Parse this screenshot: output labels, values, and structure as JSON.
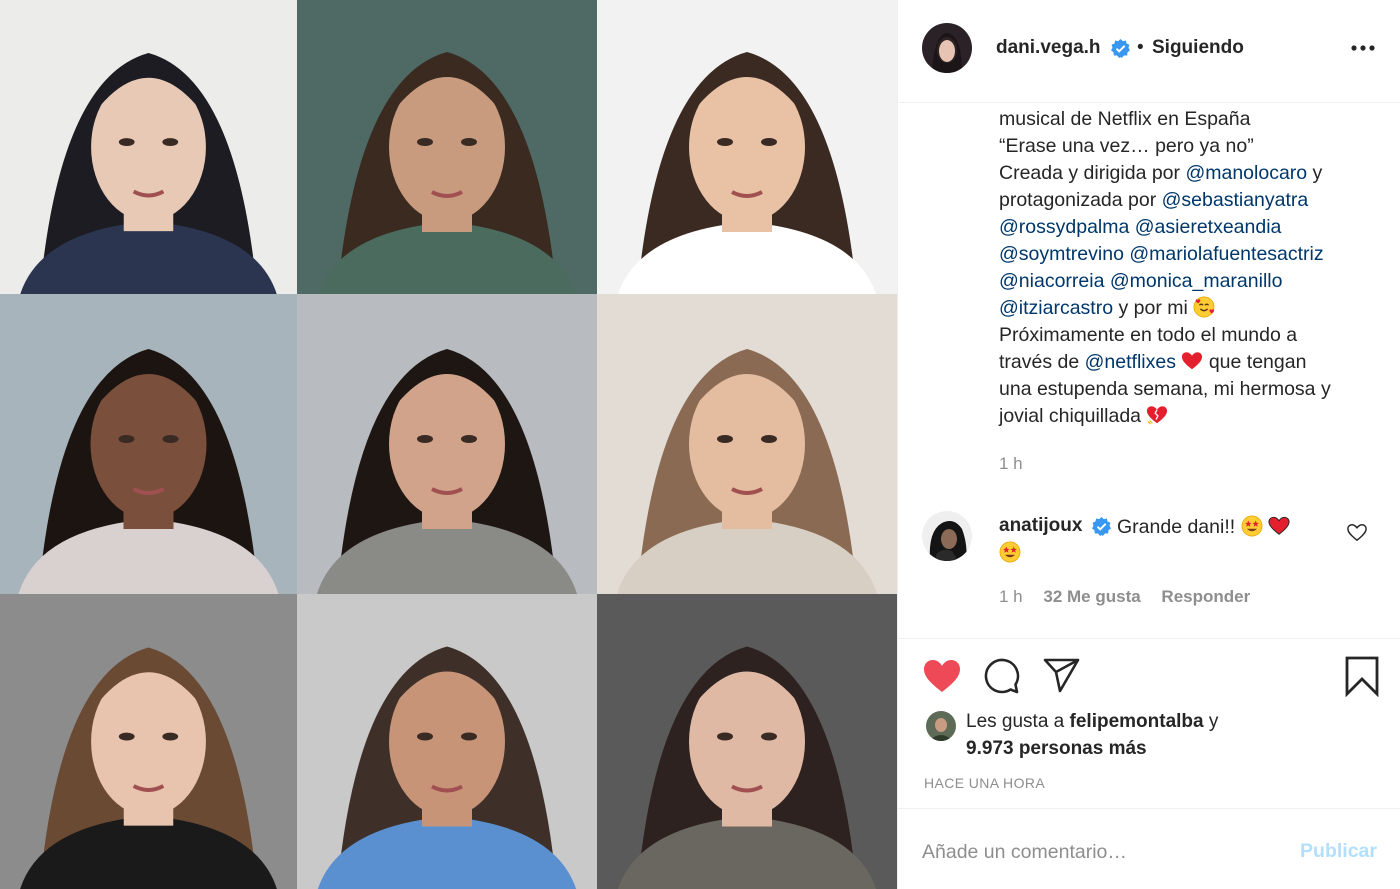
{
  "post": {
    "grid_photos": [
      {
        "name": "portrait-1",
        "bg": "#ececea",
        "skin": "#e8c9b6",
        "hair": "#1c1c22",
        "cloth": "#2b3550"
      },
      {
        "name": "portrait-2",
        "bg": "#4f6a64",
        "skin": "#c89a7e",
        "hair": "#3a2a20",
        "cloth": "#4a6b5e"
      },
      {
        "name": "portrait-3",
        "bg": "#f2f2f2",
        "skin": "#e9c2a6",
        "hair": "#3b2a22",
        "cloth": "#ffffff"
      },
      {
        "name": "portrait-4",
        "bg": "#a8b4bc",
        "skin": "#7a4f3c",
        "hair": "#1c1410",
        "cloth": "#d9d0d0"
      },
      {
        "name": "portrait-5",
        "bg": "#b8bcc0",
        "skin": "#d1a38b",
        "hair": "#1e1612",
        "cloth": "#8a8a86"
      },
      {
        "name": "portrait-6",
        "bg": "#e2dcd4",
        "skin": "#e4bca0",
        "hair": "#8a6a52",
        "cloth": "#d8cfc4"
      },
      {
        "name": "portrait-7",
        "bg": "#8c8c8c",
        "skin": "#e8c4ae",
        "hair": "#6b4a34",
        "cloth": "#1a1a1a"
      },
      {
        "name": "portrait-8",
        "bg": "#c9c9c9",
        "skin": "#c89478",
        "hair": "#3e3028",
        "cloth": "#5a8fd0"
      },
      {
        "name": "portrait-9",
        "bg": "#5a5a5a",
        "skin": "#e0b9a4",
        "hair": "#2e2220",
        "cloth": "#6a6660"
      }
    ]
  },
  "header": {
    "username": "dani.vega.h",
    "separator": "•",
    "follow_status": "Siguiendo"
  },
  "caption": {
    "lines": [
      [
        {
          "t": "musical de Netflix en España"
        }
      ],
      [
        {
          "t": "“Erase una vez… pero ya no”"
        }
      ],
      [
        {
          "t": "Creada y dirigida por "
        },
        {
          "t": "@manolocaro",
          "m": true
        },
        {
          "t": " y"
        }
      ],
      [
        {
          "t": "protagonizada por "
        },
        {
          "t": "@sebastianyatra",
          "m": true
        }
      ],
      [
        {
          "t": "@rossydpalma",
          "m": true
        },
        {
          "t": " "
        },
        {
          "t": "@asieretxeandia",
          "m": true
        }
      ],
      [
        {
          "t": "@soymtrevino",
          "m": true
        },
        {
          "t": " "
        },
        {
          "t": "@mariolafuentesactriz",
          "m": true
        }
      ],
      [
        {
          "t": "@niacorreia",
          "m": true
        },
        {
          "t": " "
        },
        {
          "t": "@monica_maranillo",
          "m": true
        }
      ],
      [
        {
          "t": "@itziarcastro",
          "m": true
        },
        {
          "t": " y por mi "
        },
        {
          "e": "smiling-hearts"
        }
      ],
      [
        {
          "t": "Próximamente en todo el mundo a"
        }
      ],
      [
        {
          "t": "través de "
        },
        {
          "t": "@netflixes",
          "m": true
        },
        {
          "t": " "
        },
        {
          "e": "red-heart"
        },
        {
          "t": " que tengan"
        }
      ],
      [
        {
          "t": "una estupenda semana, mi hermosa y"
        }
      ],
      [
        {
          "t": "jovial chiquillada "
        },
        {
          "e": "broken-heart"
        }
      ]
    ],
    "time": "1 h"
  },
  "comment": {
    "username": "anatijoux",
    "text": "Grande dani!!",
    "time": "1 h",
    "likes": "32 Me gusta",
    "reply": "Responder"
  },
  "likes": {
    "prefix": "Les gusta a ",
    "user": "felipemontalba",
    "suffix": " y",
    "others": "9.973 personas más"
  },
  "posted": "HACE UNA HORA",
  "add_comment": {
    "placeholder": "Añade un comentario…",
    "publish": "Publicar"
  },
  "colors": {
    "like_red": "#ed4956",
    "mention": "#00376b",
    "verified": "#3897f0",
    "publish_disabled": "#b2dffc"
  }
}
